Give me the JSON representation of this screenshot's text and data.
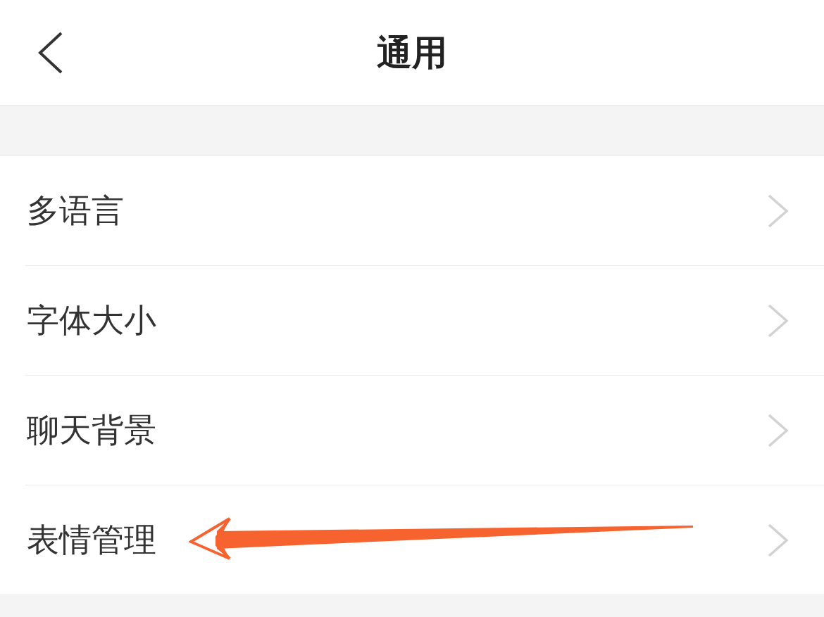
{
  "header": {
    "title": "通用"
  },
  "items": [
    {
      "label": "多语言",
      "annotated": false
    },
    {
      "label": "字体大小",
      "annotated": false
    },
    {
      "label": "聊天背景",
      "annotated": false
    },
    {
      "label": "表情管理",
      "annotated": true
    }
  ]
}
